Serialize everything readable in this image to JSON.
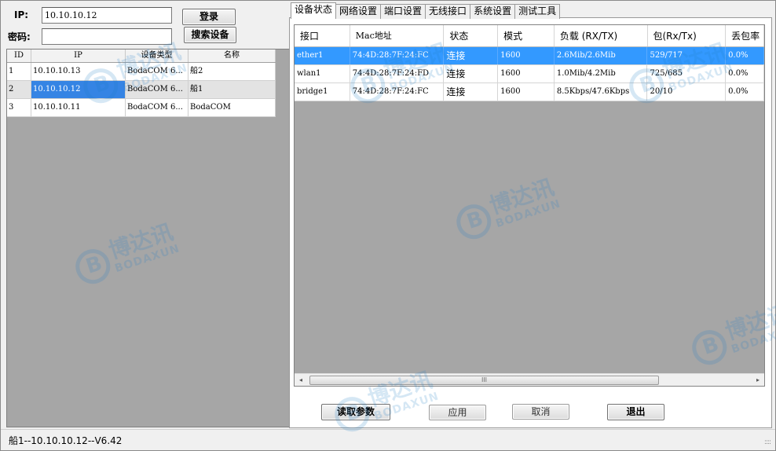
{
  "login": {
    "ip_label": "IP:",
    "ip_value": "10.10.10.12",
    "password_label": "密码:",
    "password_value": "",
    "login_button": "登录",
    "search_button": "搜索设备"
  },
  "device_table": {
    "headers": [
      "ID",
      "IP",
      "设备类型",
      "名称"
    ],
    "rows": [
      {
        "id": "1",
        "ip": "10.10.10.13",
        "type": "BodaCOM 6...",
        "name": "船2"
      },
      {
        "id": "2",
        "ip": "10.10.10.12",
        "type": "BodaCOM 6...",
        "name": "船1"
      },
      {
        "id": "3",
        "ip": "10.10.10.11",
        "type": "BodaCOM 6...",
        "name": "BodaCOM"
      }
    ]
  },
  "tabs": [
    "设备状态",
    "网络设置",
    "端口设置",
    "无线接口",
    "系统设置",
    "测试工具"
  ],
  "interface_table": {
    "headers": [
      "接口",
      "Mac地址",
      "状态",
      "模式",
      "负载 (RX/TX)",
      "包(Rx/Tx)",
      "丢包率"
    ],
    "rows": [
      {
        "iface": "ether1",
        "mac": "74:4D:28:7F:24:FC",
        "status": "连接",
        "mode": "1600",
        "load": "2.6Mib/2.6Mib",
        "packets": "529/717",
        "loss": "0.0%"
      },
      {
        "iface": "wlan1",
        "mac": "74:4D:28:7F:24:FD",
        "status": "连接",
        "mode": "1600",
        "load": "1.0Mib/4.2Mib",
        "packets": "725/685",
        "loss": "0.0%"
      },
      {
        "iface": "bridge1",
        "mac": "74:4D:28:7F:24:FC",
        "status": "连接",
        "mode": "1600",
        "load": "8.5Kbps/47.6Kbps",
        "packets": "20/10",
        "loss": "0.0%"
      }
    ]
  },
  "scrollbar": {
    "left_arrow": "◂",
    "right_arrow": "▸",
    "thumb_grip": "III"
  },
  "actions": {
    "read_params": "读取参数",
    "apply": "应用",
    "cancel": "取消",
    "exit": "退出"
  },
  "status_bar": {
    "text": "船1--10.10.10.12--V6.42",
    "grip": "::::"
  },
  "watermark": {
    "cn": "博达讯",
    "en": "BODAXUN"
  }
}
